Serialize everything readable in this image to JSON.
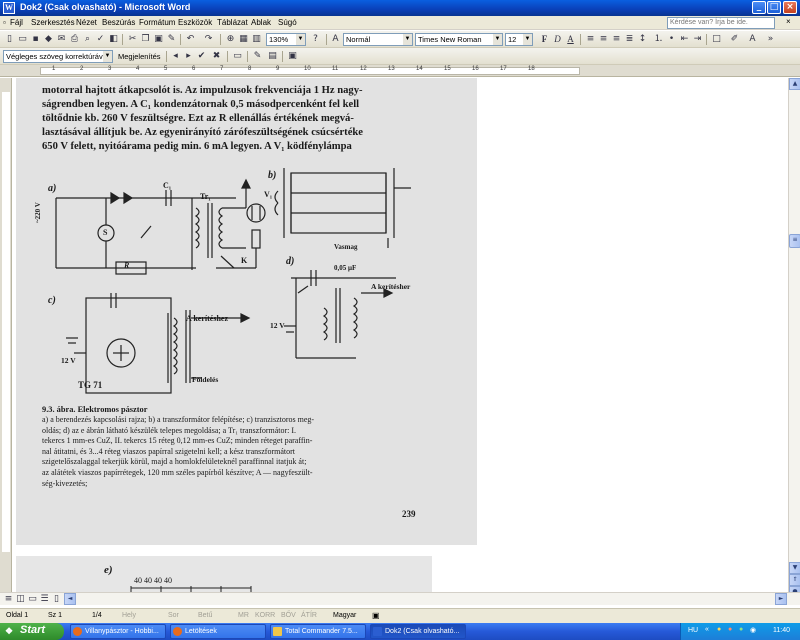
{
  "window": {
    "title": "Dok2 (Csak olvasható) - Microsoft Word",
    "app_icon": "word-icon"
  },
  "menu": {
    "items": [
      "Fájl",
      "Szerkesztés",
      "Nézet",
      "Beszúrás",
      "Formátum",
      "Eszközök",
      "Táblázat",
      "Ablak",
      "Súgó"
    ],
    "ask_placeholder": "Kérdése van? Írja be ide."
  },
  "toolbar1": {
    "zoom": "130%",
    "style": "Normál",
    "font": "Times New Roman",
    "size": "12"
  },
  "toolbar2": {
    "review_mode": "Végleges szöveg korrektúrával",
    "show": "Megjelenítés"
  },
  "ruler": {
    "numbers": [
      "1",
      "2",
      "3",
      "4",
      "5",
      "6",
      "7",
      "8",
      "9",
      "10",
      "11",
      "12",
      "13",
      "14",
      "15",
      "16",
      "17",
      "18"
    ]
  },
  "scan": {
    "paragraph": [
      "motorral hajtott átkapcsolót is. Az impulzusok frekvenciája 1 Hz nagy-",
      "ságrendben legyen. A C₁ kondenzátornak 0,5 másodpercenként fel kell",
      "töltődnie kb. 260 V feszültségre. Ezt az R ellenállás értékének megvá-",
      "lasztásával állítjuk be. Az egyenirányító zárófeszültségének csúcsértéke",
      "650 V felett, nyitóárama pedig min. 6 mA legyen. A V₁ ködfénylámpa"
    ],
    "figure_labels": {
      "a": "a)",
      "b": "b)",
      "c": "c)",
      "d": "d)",
      "e": "e)",
      "v220": "~220 V",
      "c1": "C₁",
      "v1": "V₁",
      "tr1": "Tr₁",
      "s": "S",
      "r": "R",
      "k": "K",
      "vasmag": "Vasmag",
      "cap": "0,05 μF",
      "a_keritesher": "A kerítésher",
      "a_keriteshez": "A kerítéshez",
      "v12": "12 V",
      "tg71": "TG 71",
      "foldeles": "Földelés",
      "dims": "40   40   40   40"
    },
    "caption_title": "9.3. ábra. Elektromos pásztor",
    "caption": [
      "a) a berendezés kapcsolási rajza; b) a transzformátor felépítése; c) tranzisztoros meg-",
      "oldás; d) az e ábrán látható készülék telepes megoldása; a Tr₁ transzformátor: I.",
      "tekercs 1 mm-es CuZ, II. tekercs 15 réteg 0,12 mm-es CuZ; minden réteget paraffin-",
      "nal átitatni, és 3...4 réteg viaszos papírral szigetelni kell; a kész transzformátort",
      "szigetelőszalaggal tekerjük körül, majd a homlokfelületeknél paraffinnal itatjuk át;",
      "az alátétek viaszos papírrétegek, 120 mm széles papírból készítve; A — nagyfeszült-",
      "ség-kivezetés;"
    ],
    "page_number": "239"
  },
  "status": {
    "page": "Oldal 1",
    "section": "Sz 1",
    "pages": "1/4",
    "at": "Hely",
    "line": "Sor",
    "col": "Betű",
    "rec": "MR",
    "trk": "KORR",
    "ext": "BŐV",
    "ovr": "ÁTÍR",
    "lang": "Magyar"
  },
  "taskbar": {
    "start": "Start",
    "tasks": [
      {
        "label": "Villanypásztor - Hobbi...",
        "icon_color": "#e86b1c"
      },
      {
        "label": "Letöltések",
        "icon_color": "#e86b1c"
      },
      {
        "label": "Total Commander 7.5...",
        "icon_color": "#f0c64a"
      },
      {
        "label": "Dok2 (Csak olvasható...",
        "icon_color": "#2b5ed1"
      }
    ],
    "lang": "HU",
    "clock": "11:40"
  }
}
